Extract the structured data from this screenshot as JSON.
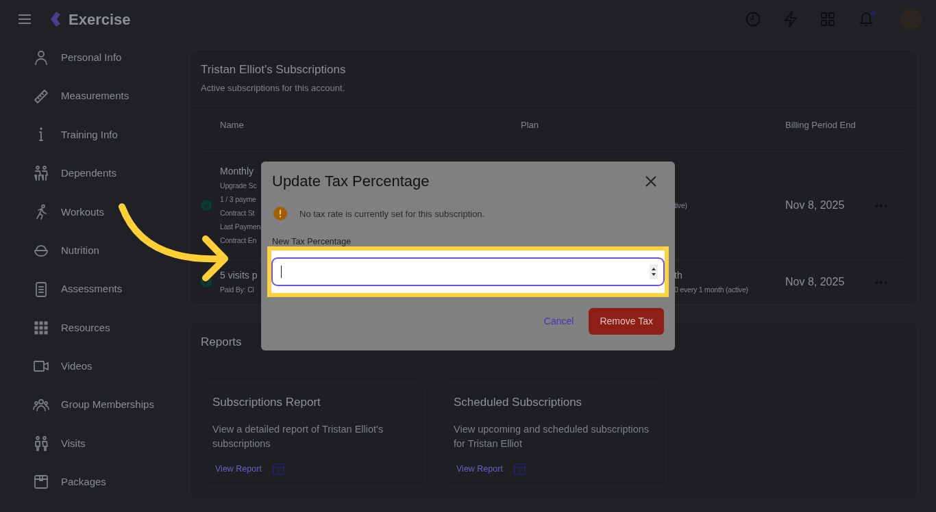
{
  "brand": "Exercise",
  "sidebar": {
    "items": [
      {
        "label": "Personal Info"
      },
      {
        "label": "Measurements"
      },
      {
        "label": "Training Info"
      },
      {
        "label": "Dependents"
      },
      {
        "label": "Workouts"
      },
      {
        "label": "Nutrition"
      },
      {
        "label": "Assessments"
      },
      {
        "label": "Resources"
      },
      {
        "label": "Videos"
      },
      {
        "label": "Group Memberships"
      },
      {
        "label": "Visits"
      },
      {
        "label": "Packages"
      }
    ]
  },
  "subscriptions": {
    "title": "Tristan Elliot's Subscriptions",
    "subtitle": "Active subscriptions for this account.",
    "columns": [
      "Name",
      "Plan",
      "Billing Period End"
    ],
    "rows": [
      {
        "name": "Monthly",
        "details": [
          "Upgrade Sc",
          "1 / 3 payme",
          "Contract St",
          "Last Paymen",
          "Contract En"
        ],
        "plan": [],
        "plan_details": [
          "tive)"
        ],
        "billing_end": "Nov 8, 2025"
      },
      {
        "name": "5 visits p",
        "details": [
          "Paid By: Cl"
        ],
        "plan": [
          "th"
        ],
        "plan_details": [
          "0 every 1 month (active)"
        ],
        "billing_end": "Nov 8, 2025"
      }
    ]
  },
  "reports": {
    "title": "Reports",
    "cards": [
      {
        "title": "Subscriptions Report",
        "description": "View a detailed report of Tristan Elliot's subscriptions",
        "link": "View Report"
      },
      {
        "title": "Scheduled Subscriptions",
        "description": "View upcoming and scheduled subscriptions for Tristan Elliot",
        "link": "View Report"
      }
    ]
  },
  "modal": {
    "title": "Update Tax Percentage",
    "notice": "No tax rate is currently set for this subscription.",
    "field": {
      "label": "New Tax Percentage"
    },
    "buttons": [
      {
        "label": "Cancel",
        "kind": "link"
      },
      {
        "label": "Remove Tax",
        "kind": "danger"
      }
    ]
  }
}
